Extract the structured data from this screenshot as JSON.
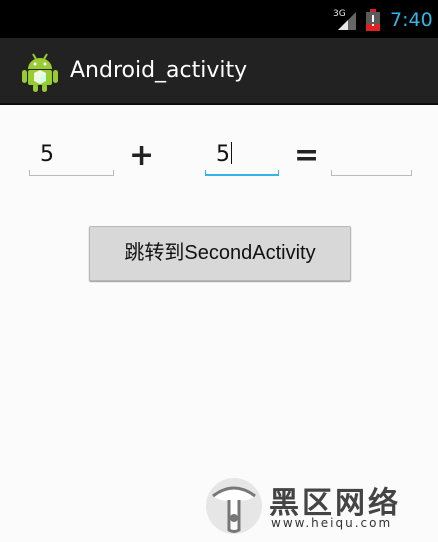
{
  "status_bar": {
    "network": "3G",
    "time": "7:40",
    "clock_color": "#33b5e5"
  },
  "action_bar": {
    "icon": "android-icon",
    "title": "Android_activity"
  },
  "form": {
    "operand_a": "5",
    "plus_symbol": "+",
    "operand_b": "5",
    "equals_symbol": "=",
    "result": ""
  },
  "jump_button": {
    "label": "跳转到SecondActivity"
  },
  "watermark": {
    "name": "黑区网络",
    "url": "www.heiqu.com"
  }
}
